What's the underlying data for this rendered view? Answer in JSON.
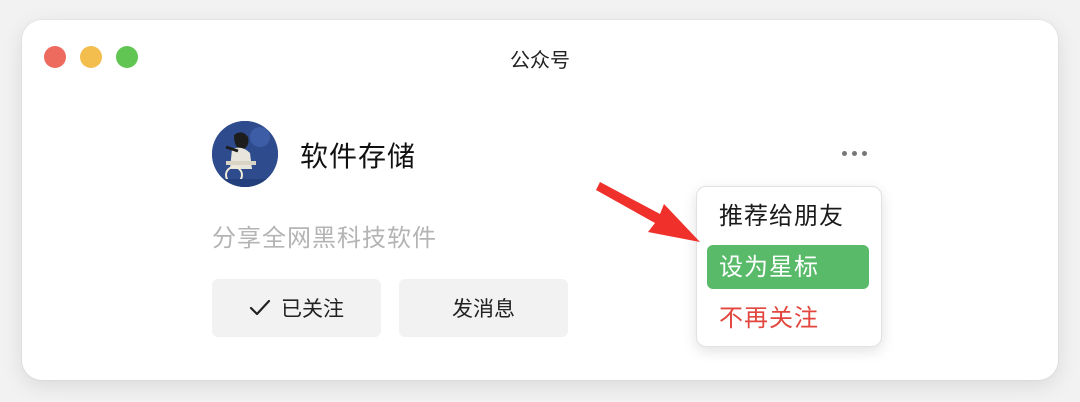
{
  "window": {
    "title": "公众号"
  },
  "account": {
    "name": "软件存储",
    "description": "分享全网黑科技软件"
  },
  "actions": {
    "follow_label": "已关注",
    "message_label": "发消息"
  },
  "menu": {
    "items": [
      {
        "label": "推荐给朋友"
      },
      {
        "label": "设为星标"
      },
      {
        "label": "不再关注"
      }
    ]
  },
  "colors": {
    "traffic_close": "#ed6a5e",
    "traffic_minimize": "#f4be4f",
    "traffic_maximize": "#61c554",
    "menu_highlight": "#59bb6a",
    "danger": "#e2463d",
    "annotation_arrow": "#f0302b"
  },
  "icons": {
    "more": "more-horizontal-icon",
    "follow_check": "checkmark-icon",
    "annotation": "red-arrow-icon"
  }
}
